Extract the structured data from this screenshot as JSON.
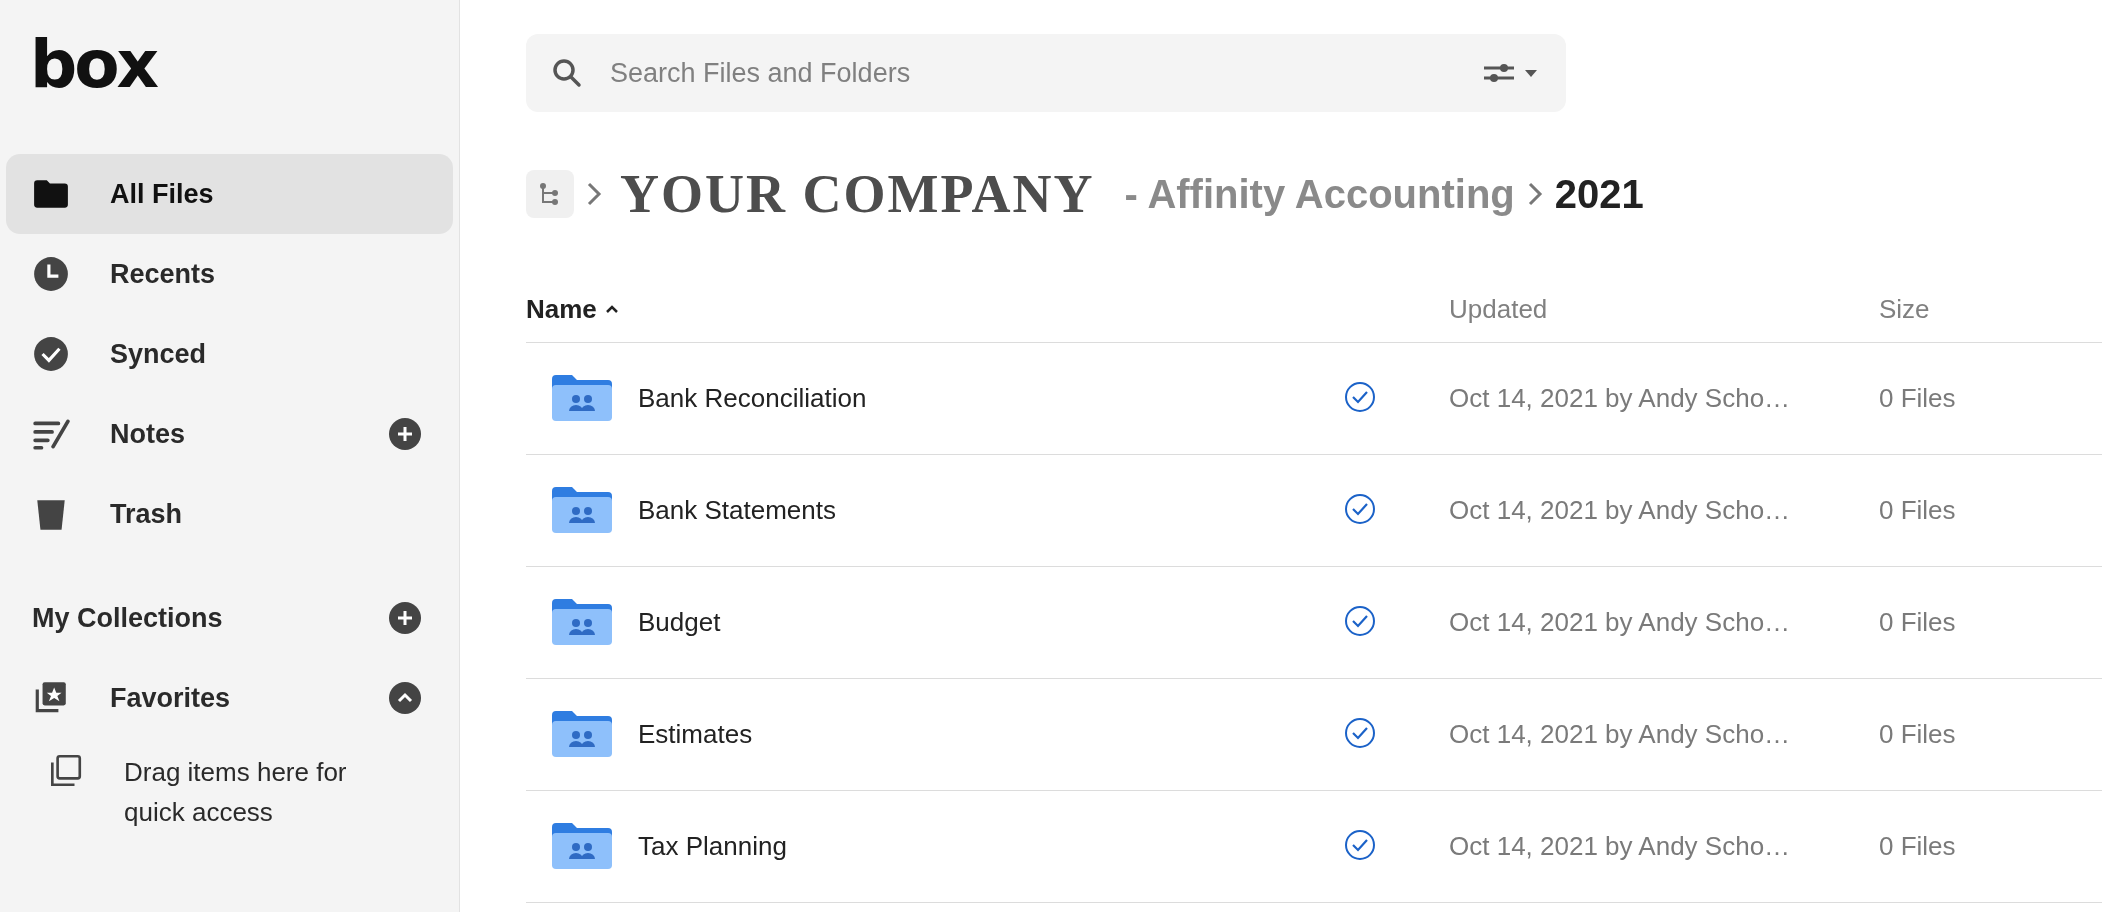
{
  "sidebar": {
    "logo": "box",
    "items": [
      {
        "label": "All Files",
        "kind": "folder",
        "selected": true
      },
      {
        "label": "Recents",
        "kind": "recent",
        "selected": false
      },
      {
        "label": "Synced",
        "kind": "synced",
        "selected": false
      },
      {
        "label": "Notes",
        "kind": "notes",
        "selected": false
      },
      {
        "label": "Trash",
        "kind": "trash",
        "selected": false
      }
    ],
    "collections": {
      "title": "My Collections"
    },
    "favorites": {
      "label": "Favorites",
      "expanded": true,
      "empty_hint": "Drag items here for quick access"
    }
  },
  "search": {
    "placeholder": "Search Files and Folders"
  },
  "breadcrumb": {
    "company": "YOUR COMPANY",
    "suffix": "- Affinity Accounting",
    "current": "2021"
  },
  "table": {
    "columns": [
      {
        "label": "Name",
        "sorted_ascending": true
      },
      {
        "label": "Updated"
      },
      {
        "label": "Size"
      }
    ],
    "rows": [
      {
        "name": "Bank Reconciliation",
        "synced": true,
        "updated": "Oct 14, 2021 by Andy Scho…",
        "size": "0 Files"
      },
      {
        "name": "Bank Statements",
        "synced": true,
        "updated": "Oct 14, 2021 by Andy Scho…",
        "size": "0 Files"
      },
      {
        "name": "Budget",
        "synced": true,
        "updated": "Oct 14, 2021 by Andy Scho…",
        "size": "0 Files"
      },
      {
        "name": "Estimates",
        "synced": true,
        "updated": "Oct 14, 2021 by Andy Scho…",
        "size": "0 Files"
      },
      {
        "name": "Tax Planning",
        "synced": true,
        "updated": "Oct 14, 2021 by Andy Scho…",
        "size": "0 Files"
      }
    ]
  }
}
